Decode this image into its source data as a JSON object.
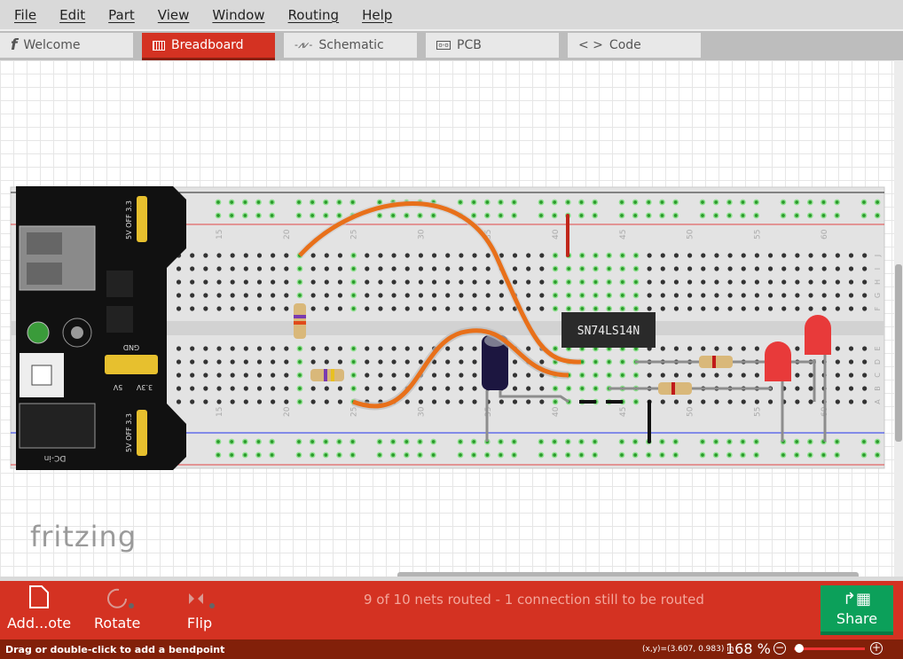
{
  "menu": [
    "File",
    "Edit",
    "Part",
    "View",
    "Window",
    "Routing",
    "Help"
  ],
  "tabs": [
    {
      "label": "Welcome",
      "icon": "fritzing-f-icon"
    },
    {
      "label": "Breadboard",
      "icon": "breadboard-icon",
      "active": true
    },
    {
      "label": "Schematic",
      "icon": "resistor-symbol-icon"
    },
    {
      "label": "PCB",
      "icon": "pcb-icon"
    },
    {
      "label": "Code",
      "icon": "code-brackets-icon"
    }
  ],
  "canvas": {
    "logo": "fritzing",
    "ic_label": "SN74LS14N",
    "column_labels": [
      "15",
      "20",
      "25",
      "30",
      "35",
      "40",
      "45",
      "50",
      "55",
      "60"
    ],
    "row_labels_top": [
      "J",
      "I",
      "H",
      "G",
      "F"
    ],
    "row_labels_bottom": [
      "E",
      "D",
      "C",
      "B",
      "A"
    ],
    "power_module": {
      "top_jumper": [
        "3.3",
        "OFF",
        "5V"
      ],
      "gnd": "GND",
      "pins": [
        "5V",
        "3.3V"
      ],
      "bottom_jumper": [
        "3.3",
        "OFF",
        "5V"
      ],
      "dc": "DC-in"
    }
  },
  "toolbar": {
    "add_note": "Add...ote",
    "rotate": "Rotate",
    "flip": "Flip",
    "routing_status": "9 of 10 nets routed - 1 connection still to be routed",
    "share": "Share"
  },
  "status": {
    "hint": "Drag or double-click to add a bendpoint",
    "coords": "(x,y)=(3.607, 0.983) in",
    "zoom": "168 %",
    "zoom_level_fraction": 0.05
  },
  "colors": {
    "accent": "#d43222",
    "share": "#0ca05a",
    "status_bar": "#822009",
    "wire": "#e8701a"
  }
}
